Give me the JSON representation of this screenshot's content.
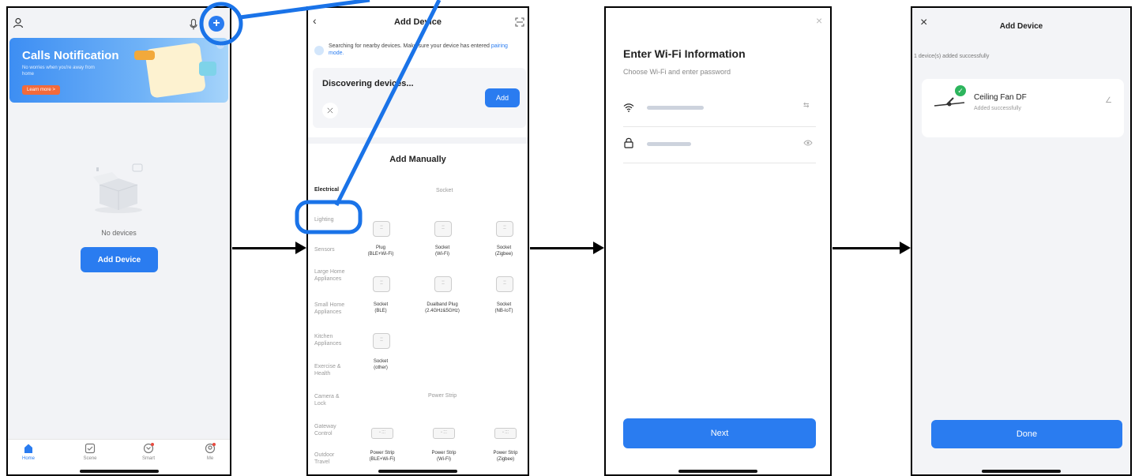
{
  "screen1": {
    "banner": {
      "title": "Calls Notification",
      "subtitle": "No worries when you're away from home",
      "learn_more": "Learn more >"
    },
    "empty_text": "No devices",
    "add_device": "Add Device",
    "tabs": [
      {
        "label": "Home",
        "icon": "home-icon"
      },
      {
        "label": "Scene",
        "icon": "scene-icon"
      },
      {
        "label": "Smart",
        "icon": "smart-icon"
      },
      {
        "label": "Me",
        "icon": "me-icon"
      }
    ]
  },
  "screen2": {
    "title": "Add Device",
    "search_text": "Searching for nearby devices. Make sure your device has entered",
    "pairing_link": "pairing mode.",
    "discovering": "Discovering devices...",
    "add_button": "Add",
    "add_manually": "Add Manually",
    "categories": [
      "Electrical",
      "Lighting",
      "Sensors",
      "Large Home Appliances",
      "Small Home Appliances",
      "Kitchen Appliances",
      "Exercise & Health",
      "Camera & Lock",
      "Gateway Control",
      "Outdoor Travel"
    ],
    "section_socket": "Socket",
    "section_power_strip": "Power Strip",
    "devices": [
      {
        "name": "Plug",
        "sub": "(BLE+Wi-Fi)"
      },
      {
        "name": "Socket",
        "sub": "(Wi-Fi)"
      },
      {
        "name": "Socket",
        "sub": "(Zigbee)"
      },
      {
        "name": "Socket",
        "sub": "(BLE)"
      },
      {
        "name": "Dualband Plug",
        "sub": "(2.4GHz&5GHz)"
      },
      {
        "name": "Socket",
        "sub": "(NB-IoT)"
      },
      {
        "name": "Socket",
        "sub": "(other)"
      }
    ],
    "strips": [
      {
        "name": "Power Strip",
        "sub": "(BLE+Wi-Fi)"
      },
      {
        "name": "Power Strip",
        "sub": "(Wi-Fi)"
      },
      {
        "name": "Power Strip",
        "sub": "(Zigbee)"
      }
    ]
  },
  "screen3": {
    "title": "Enter Wi-Fi Information",
    "subtitle": "Choose Wi-Fi and enter password",
    "next": "Next"
  },
  "screen4": {
    "title": "Add Device",
    "status": "1 device(s) added successfully",
    "device_name": "Ceiling Fan DF",
    "device_status": "Added successfully",
    "done": "Done"
  },
  "colors": {
    "accent": "#2a7cf0",
    "annotation": "#1a73e8",
    "success": "#2db55d"
  }
}
